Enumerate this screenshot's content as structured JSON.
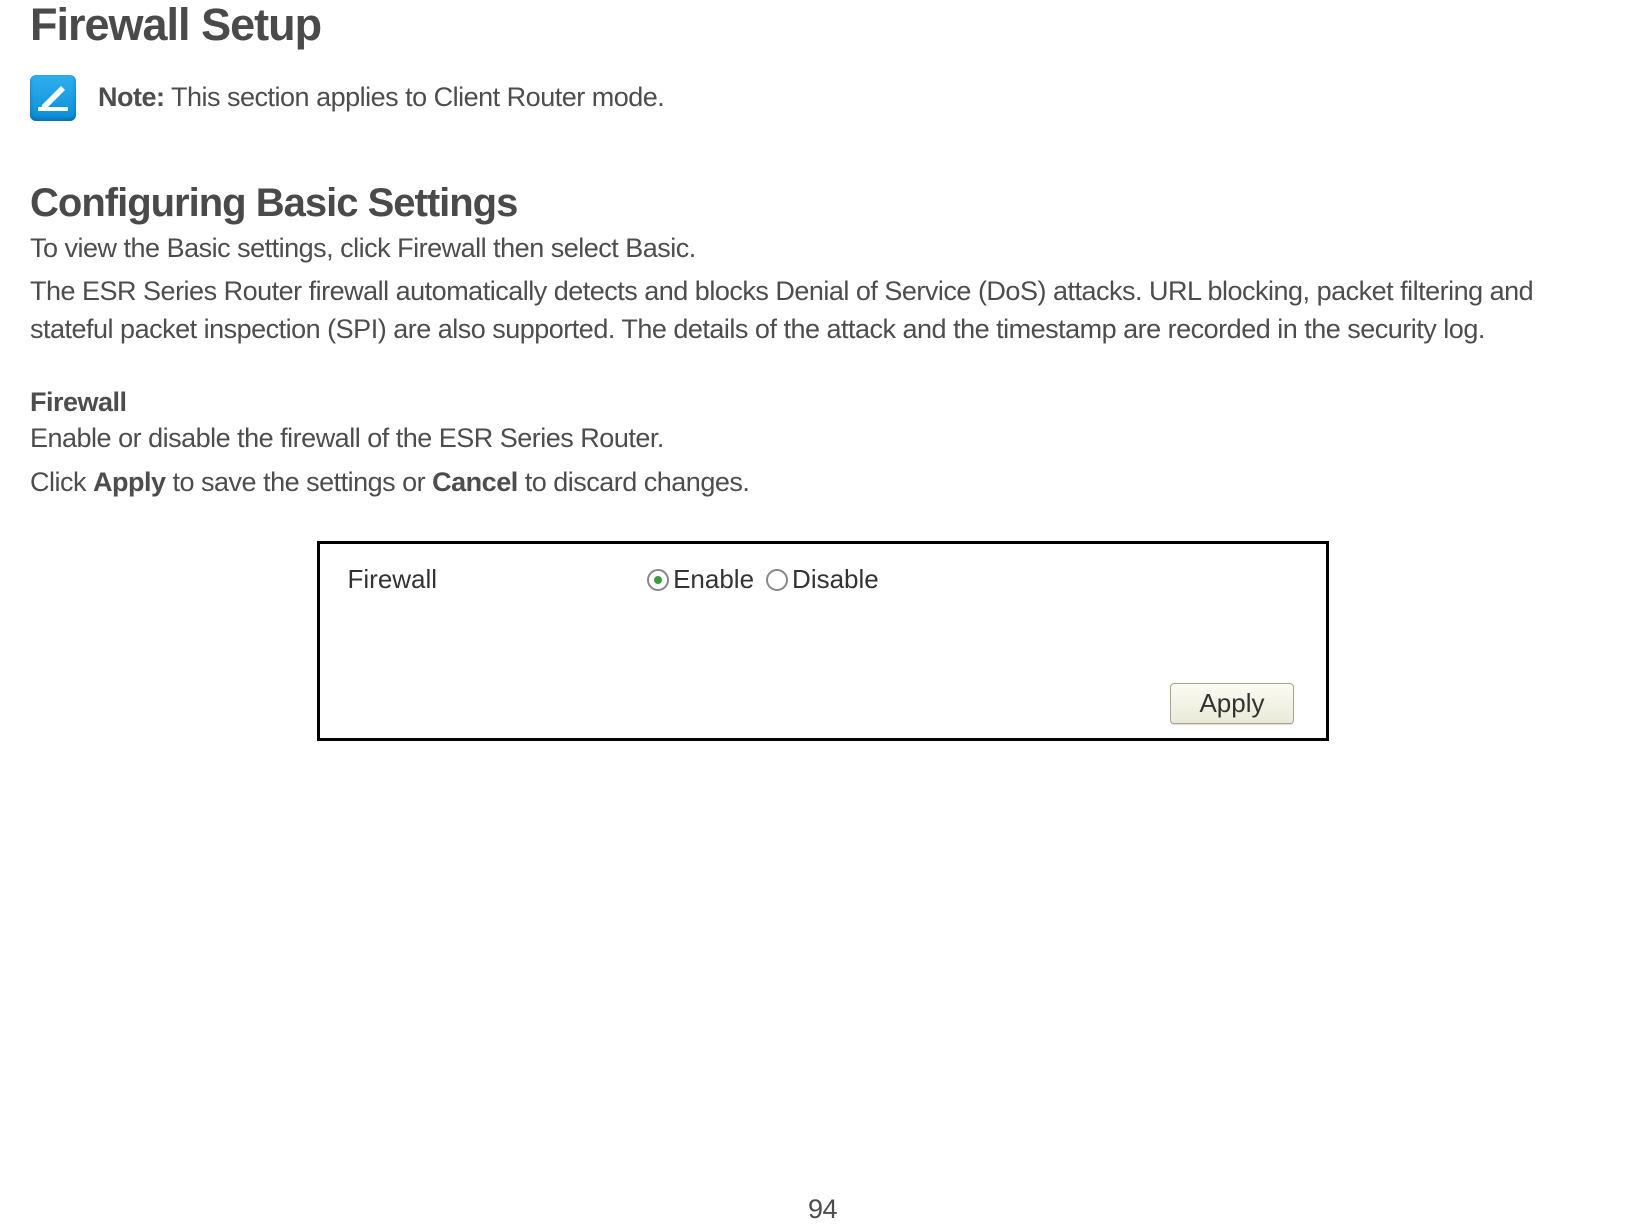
{
  "page_title": "Firewall Setup",
  "note": {
    "label": "Note:",
    "text": "This section applies to Client Router mode."
  },
  "subheading": "Configuring Basic Settings",
  "intro_p1": "To view the Basic settings, click Firewall then select Basic.",
  "intro_p2": "The ESR Series Router firewall automatically detects and blocks Denial of Service (DoS) attacks. URL blocking, packet filtering and stateful packet inspection (SPI) are also supported. The details of the attack and the timestamp are recorded in the security log.",
  "firewall": {
    "heading": "Firewall",
    "description": "Enable or disable the firewall of the ESR Series Router.",
    "instruction_prefix": "Click ",
    "apply_word": "Apply",
    "instruction_mid": " to save the settings or ",
    "cancel_word": "Cancel",
    "instruction_suffix": " to discard changes."
  },
  "panel": {
    "label": "Firewall",
    "enable_label": "Enable",
    "disable_label": "Disable",
    "selected": "enable",
    "apply_button": "Apply"
  },
  "page_number": "94"
}
